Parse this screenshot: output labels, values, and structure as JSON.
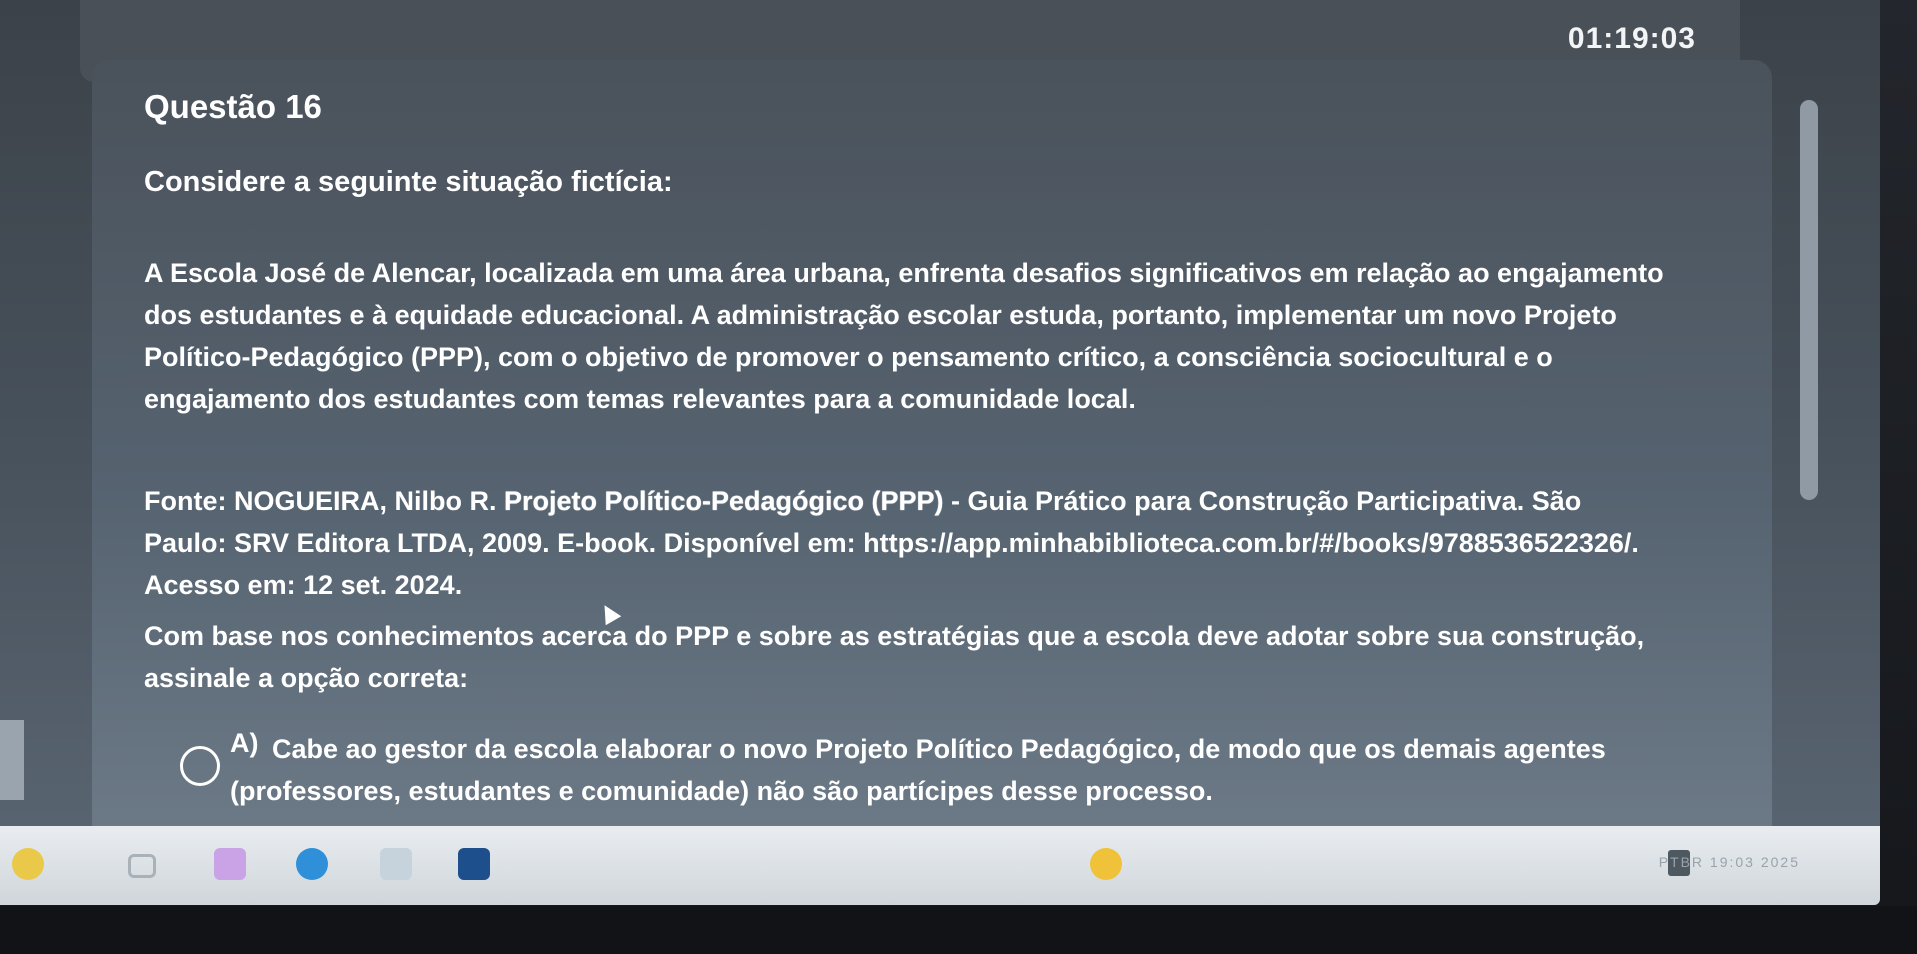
{
  "timer": "01:19:03",
  "question": {
    "title": "Questão 16",
    "intro": "Considere a seguinte situação fictícia:",
    "scenario": "A Escola José de Alencar, localizada em uma área urbana, enfrenta desafios significativos em relação ao engajamento dos estudantes e à equidade educacional. A administração escolar estuda, portanto, implementar um novo Projeto Político-Pedagógico (PPP), com o objetivo de promover o pensamento crítico, a consciência sociocultural e o engajamento dos estudantes com temas relevantes para a comunidade local.",
    "source_prefix": "Fonte: NOGUEIRA, Nilbo R. ",
    "source_title": "Projeto Político-Pedagógico (PPP)",
    "source_suffix": " - Guia Prático para Construção Participativa. São Paulo: SRV Editora LTDA, 2009. E-book. Disponível em: https://app.minhabiblioteca.com.br/#/books/9788536522326/. Acesso em: 12 set. 2024.",
    "prompt": "Com base nos conhecimentos acerca do PPP e sobre as estratégias que a escola deve adotar sobre sua construção, assinale a opção correta:",
    "options": [
      {
        "letter": "A)",
        "text": "Cabe ao gestor da escola elaborar o novo Projeto Político Pedagógico, de modo que os demais agentes (professores, estudantes e comunidade) não são partícipes desse processo."
      }
    ]
  },
  "taskbar": {
    "tray_text": "PTBR  19:03  2025"
  },
  "icons": {
    "widget": "weather-widget-icon",
    "task_view": "task-view-icon",
    "app1": "app-icon",
    "browser": "edge-browser-icon",
    "app2": "app-icon",
    "app3": "app-icon",
    "app4": "app-icon",
    "notification": "notification-icon"
  }
}
